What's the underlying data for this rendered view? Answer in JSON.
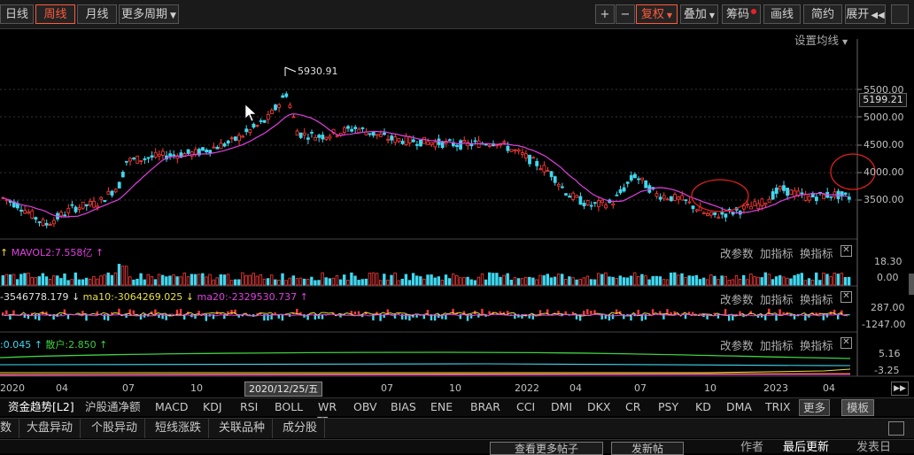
{
  "toolbar": {
    "left": [
      "日线",
      "周线",
      "月线",
      "更多周期"
    ],
    "active": "周线",
    "right": {
      "plus": "+",
      "minus": "−",
      "fuquan": "复权",
      "diejia": "叠加",
      "chouma": "筹码",
      "huaxian": "画线",
      "jianyue": "简约",
      "zhankai": "展开"
    }
  },
  "settings_label": "设置均线",
  "main_chart": {
    "y_ticks": [
      "5500.00",
      "5000.00",
      "4500.00",
      "4000.00",
      "3500.00"
    ],
    "high_label": "5930.91",
    "price_label": "5199.21"
  },
  "volume_panel": {
    "label_prefix": "↑",
    "label": "MAVOL2:7.558亿",
    "label_suffix": "↑",
    "controls": [
      "改参数",
      "加指标",
      "换指标"
    ],
    "y_ticks": [
      "18.30",
      "0.00"
    ]
  },
  "flow_panel": {
    "label1": "-3546778.179 ↓",
    "label2": "ma10:-3064269.025 ↓",
    "label3": "ma20:-2329530.737 ↑",
    "controls": [
      "改参数",
      "加指标",
      "换指标"
    ],
    "y_ticks": [
      "287.00",
      "-1247.00"
    ]
  },
  "third_panel": {
    "label1": ":0.045 ↑",
    "label2": "散户:2.850 ↑",
    "controls": [
      "改参数",
      "加指标",
      "换指标"
    ],
    "y_ticks": [
      "5.16",
      "-3.25"
    ]
  },
  "time_axis": {
    "labels": [
      "2020",
      "04",
      "07",
      "10",
      "07",
      "10",
      "2022",
      "04",
      "07",
      "10",
      "2023",
      "04"
    ],
    "crosshair_date": "2020/12/25/五"
  },
  "indicator_tabs": [
    "资金趋势[L2]",
    "沪股通净额",
    "MACD",
    "KDJ",
    "RSI",
    "BOLL",
    "WR",
    "OBV",
    "BIAS",
    "ENE",
    "BRAR",
    "CCI",
    "DMI",
    "DKX",
    "CR",
    "PSY",
    "KD",
    "DMA",
    "TRIX",
    "更多",
    "模板"
  ],
  "bottom_tabs": [
    "数",
    "大盘异动",
    "个股异动",
    "短线涨跌",
    "关联品种",
    "成分股"
  ],
  "bottom_row": [
    "查看更多帖子",
    "发新帖",
    "作者",
    "最后更新",
    "发表日"
  ],
  "colors": {
    "up": "#ff3b3b",
    "down": "#3fd8f0",
    "ma": "#e040e0",
    "volume_label": "#e040e0",
    "active": "#ff5a3c"
  }
}
